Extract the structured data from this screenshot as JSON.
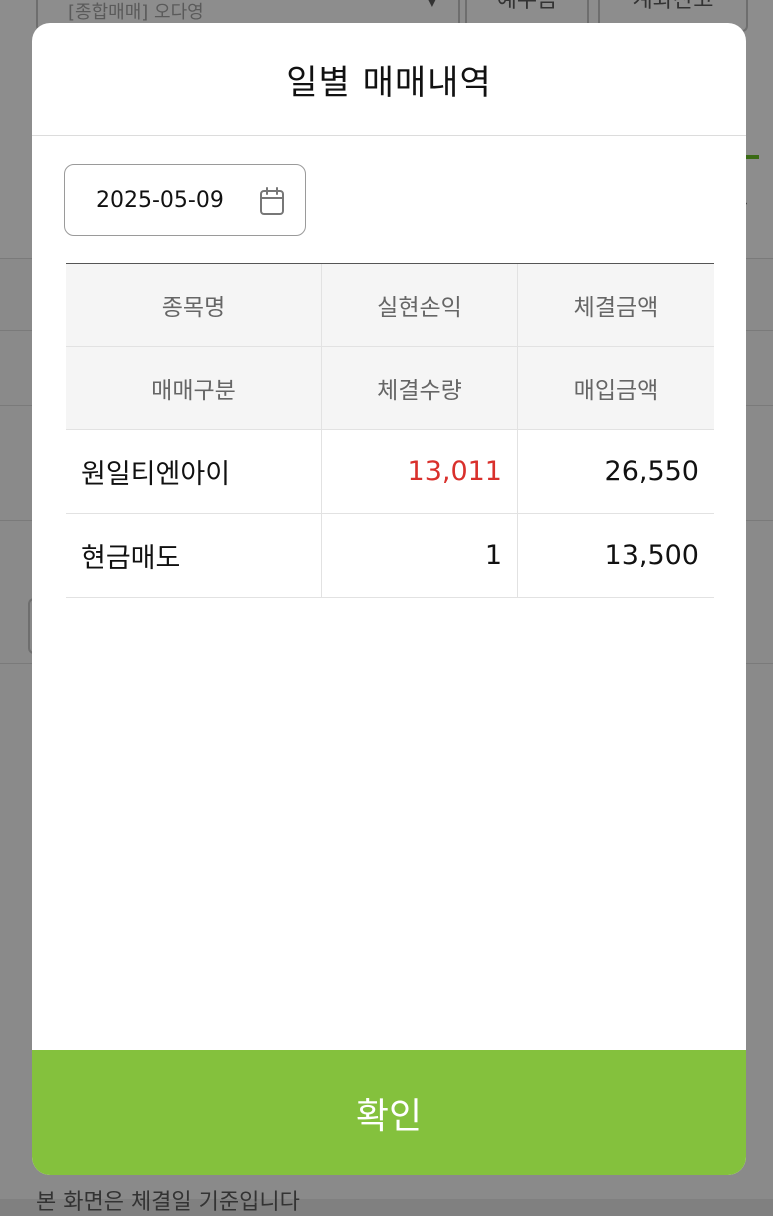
{
  "background": {
    "account_select": "[종합매매] 오다영",
    "button_1": "예수금",
    "button_2": "계좌잔고",
    "bottom_note": "본 화면은 체결일 기준입니다"
  },
  "modal": {
    "title": "일별 매매내역",
    "date_value": "2025-05-09",
    "headers": {
      "row1": [
        "종목명",
        "실현손익",
        "체결금액"
      ],
      "row2": [
        "매매구분",
        "체결수량",
        "매입금액"
      ]
    },
    "rows": [
      {
        "stock_name": "원일티엔아이",
        "realized_pnl": "13,011",
        "trade_amount": "26,550"
      },
      {
        "trade_type": "현금매도",
        "quantity": "1",
        "purchase_amount": "13,500"
      }
    ],
    "confirm_label": "확인"
  },
  "colors": {
    "accent": "#84c13d",
    "profit": "#d9302c"
  },
  "icons": {
    "date": "calendar-icon"
  }
}
